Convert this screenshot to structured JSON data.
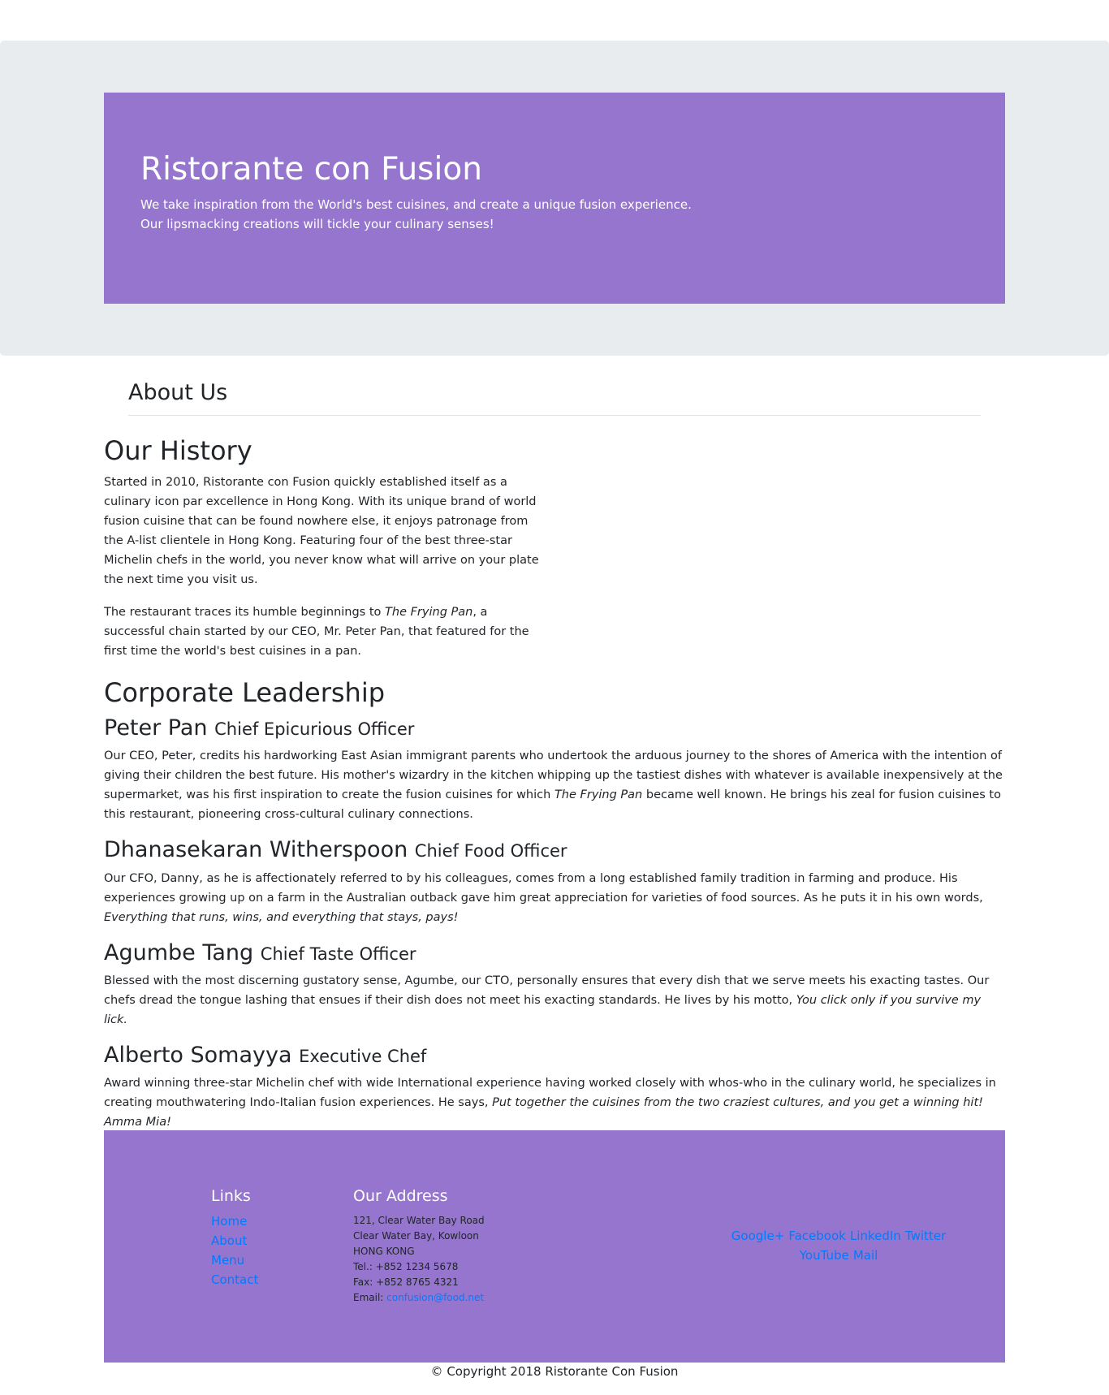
{
  "hero": {
    "title": "Ristorante con Fusion",
    "subtitle": "We take inspiration from the World's best cuisines, and create a unique fusion experience. Our lipsmacking creations will tickle your culinary senses!"
  },
  "about": {
    "heading": "About Us"
  },
  "history": {
    "heading": "Our History",
    "p1": "Started in 2010, Ristorante con Fusion quickly established itself as a culinary icon par excellence in Hong Kong. With its unique brand of world fusion cuisine that can be found nowhere else, it enjoys patronage from the A-list clientele in Hong Kong. Featuring four of the best three-star Michelin chefs in the world, you never know what will arrive on your plate the next time you visit us.",
    "p2_before": "The restaurant traces its humble beginnings to ",
    "p2_em": "The Frying Pan",
    "p2_after": ", a successful chain started by our CEO, Mr. Peter Pan, that featured for the first time the world's best cuisines in a pan."
  },
  "leadership": {
    "heading": "Corporate Leadership",
    "leaders": [
      {
        "name": "Peter Pan",
        "title": "Chief Epicurious Officer",
        "desc_before": "Our CEO, Peter, credits his hardworking East Asian immigrant parents who undertook the arduous journey to the shores of America with the intention of giving their children the best future. His mother's wizardry in the kitchen whipping up the tastiest dishes with whatever is available inexpensively at the supermarket, was his first inspiration to create the fusion cuisines for which ",
        "desc_em": "The Frying Pan",
        "desc_after": " became well known. He brings his zeal for fusion cuisines to this restaurant, pioneering cross-cultural culinary connections."
      },
      {
        "name": "Dhanasekaran Witherspoon",
        "title": "Chief Food Officer",
        "desc_before": "Our CFO, Danny, as he is affectionately referred to by his colleagues, comes from a long established family tradition in farming and produce. His experiences growing up on a farm in the Australian outback gave him great appreciation for varieties of food sources. As he puts it in his own words, ",
        "desc_em": "Everything that runs, wins, and everything that stays, pays!",
        "desc_after": ""
      },
      {
        "name": "Agumbe Tang",
        "title": "Chief Taste Officer",
        "desc_before": "Blessed with the most discerning gustatory sense, Agumbe, our CTO, personally ensures that every dish that we serve meets his exacting tastes. Our chefs dread the tongue lashing that ensues if their dish does not meet his exacting standards. He lives by his motto, ",
        "desc_em": "You click only if you survive my lick.",
        "desc_after": ""
      },
      {
        "name": "Alberto Somayya",
        "title": "Executive Chef",
        "desc_before": "Award winning three-star Michelin chef with wide International experience having worked closely with whos-who in the culinary world, he specializes in creating mouthwatering Indo-Italian fusion experiences. He says, ",
        "desc_em": "Put together the cuisines from the two craziest cultures, and you get a winning hit! Amma Mia!",
        "desc_after": ""
      }
    ]
  },
  "footer": {
    "links_heading": "Links",
    "links": [
      "Home",
      "About",
      "Menu",
      "Contact"
    ],
    "address_heading": "Our Address",
    "address_lines": [
      "121, Clear Water Bay Road",
      "Clear Water Bay, Kowloon",
      "HONG KONG",
      "Tel.: +852 1234 5678",
      "Fax: +852 8765 4321"
    ],
    "email_label": "Email: ",
    "email": "confusion@food.net",
    "social": [
      "Google+",
      "Facebook",
      "LinkedIn",
      "Twitter",
      "YouTube",
      "Mail"
    ]
  },
  "copyright": "© Copyright 2018 Ristorante Con Fusion",
  "colors": {
    "brand_purple": "#9575cd",
    "jumbotron_gray": "#e9ecef",
    "link_blue": "#007bff"
  }
}
